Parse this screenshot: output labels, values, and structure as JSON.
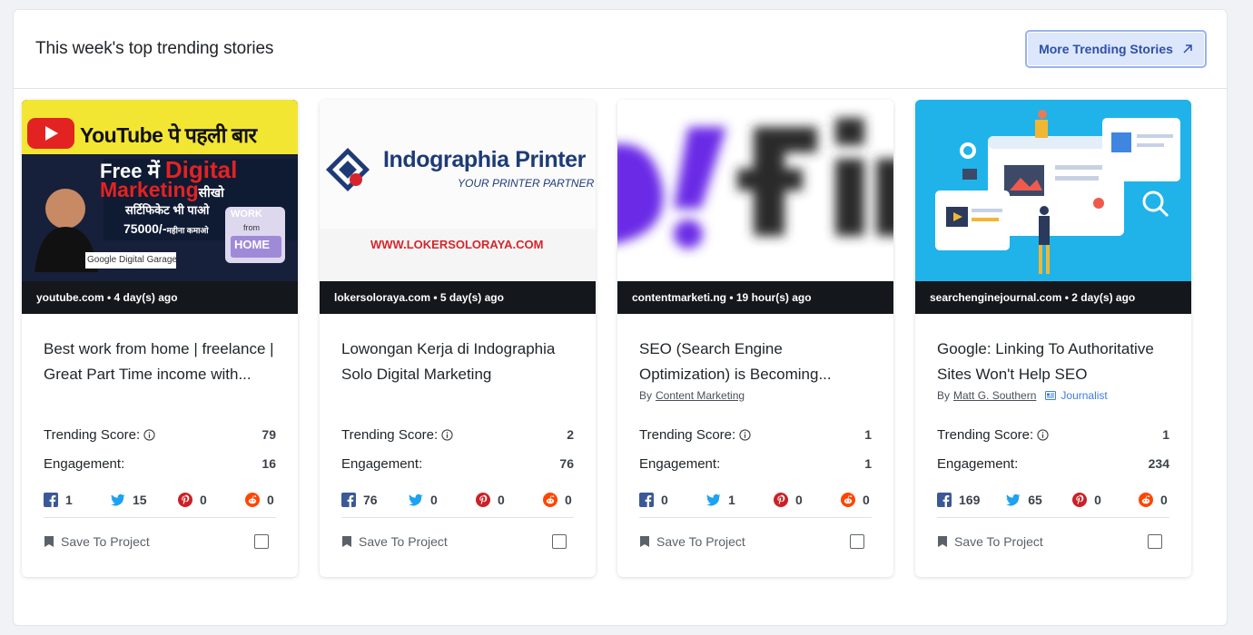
{
  "header": {
    "title": "This week's top trending stories",
    "more_label": "More Trending Stories"
  },
  "labels": {
    "trending": "Trending Score:",
    "engagement": "Engagement:",
    "save": "Save To Project",
    "by": "By"
  },
  "colors": {
    "facebook": "#3b5998",
    "twitter": "#1da1f2",
    "pinterest": "#cb2027",
    "reddit": "#ff4500",
    "accent": "#2d4fa7"
  },
  "cards": [
    {
      "meta": "youtube.com • 4 day(s) ago",
      "title": "Best work from home | freelance | Great Part Time income with...",
      "author": "",
      "journalist": "",
      "trending": "79",
      "engagement": "16",
      "facebook": "1",
      "twitter": "15",
      "pinterest": "0",
      "reddit": "0",
      "thumb": {
        "brand": "YouTube पे पहली बार",
        "line1a": "Free में ",
        "line1b": "Digital",
        "line2a": "Marketing",
        "line2b": "सीखो",
        "line3": "सर्टिफिकेट भी पाओ",
        "line4a": "75000/-",
        "line4b": "महीना कमाओ",
        "badge": "Google Digital Garage",
        "work1": "WORK",
        "work2": "from",
        "work3": "HOME"
      }
    },
    {
      "meta": "lokersoloraya.com • 5 day(s) ago",
      "title": "Lowongan Kerja di Indographia Solo Digital Marketing",
      "author": "",
      "journalist": "",
      "trending": "2",
      "engagement": "76",
      "facebook": "76",
      "twitter": "0",
      "pinterest": "0",
      "reddit": "0",
      "thumb": {
        "brand": "Indographia Printer",
        "tagline": "YOUR PRINTER PARTNER",
        "url": "WWW.LOKERSOLORAYA.COM"
      }
    },
    {
      "meta": "contentmarketi.ng • 19 hour(s) ago",
      "title": "SEO (Search Engine Optimization) is Becoming...",
      "author": "Content Marketing",
      "journalist": "",
      "trending": "1",
      "engagement": "1",
      "facebook": "0",
      "twitter": "1",
      "pinterest": "0",
      "reddit": "0",
      "thumb": {}
    },
    {
      "meta": "searchenginejournal.com • 2 day(s) ago",
      "title": "Google: Linking To Authoritative Sites Won't Help SEO",
      "author": "Matt G. Southern",
      "journalist": "Journalist",
      "trending": "1",
      "engagement": "234",
      "facebook": "169",
      "twitter": "65",
      "pinterest": "0",
      "reddit": "0",
      "thumb": {}
    }
  ]
}
